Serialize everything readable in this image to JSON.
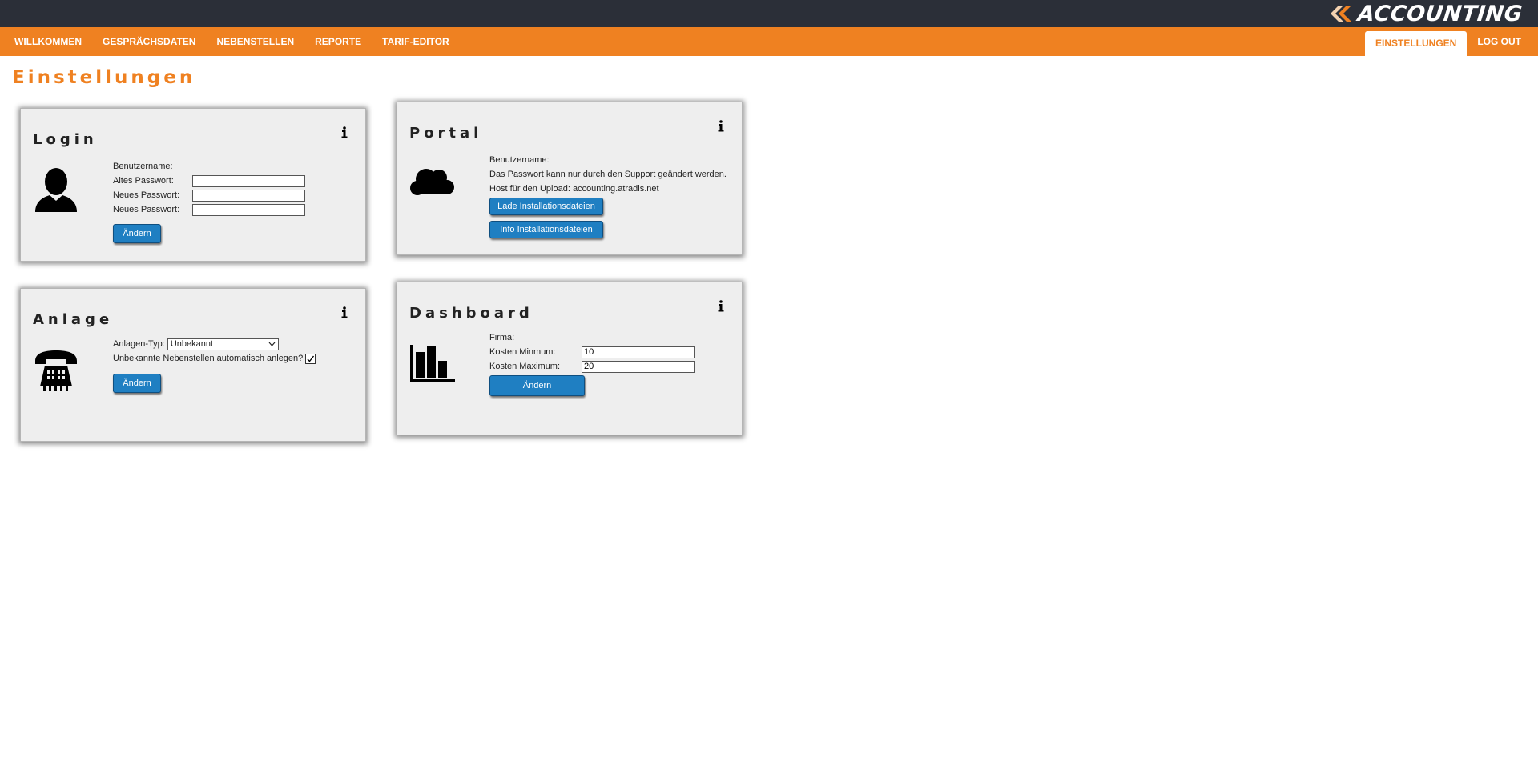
{
  "header": {
    "logo_text": "ACCOUNTING",
    "brand_color": "#ef8121",
    "topbar_color": "#2b2f38"
  },
  "nav": {
    "left": [
      "WILLKOMMEN",
      "GESPRÄCHSDATEN",
      "NEBENSTELLEN",
      "REPORTE",
      "TARIF-EDITOR"
    ],
    "settings": "EINSTELLUNGEN",
    "logout": "LOG OUT",
    "active": "EINSTELLUNGEN"
  },
  "page": {
    "title": "Einstellungen"
  },
  "login": {
    "title": "Login",
    "icon": "user-icon",
    "username_label": "Benutzername:",
    "old_password_label": "Altes Passwort:",
    "new_password_label": "Neues Passwort:",
    "new_password_repeat_label": "Neues Passwort:",
    "old_password_value": "",
    "new_password_value": "",
    "new_password_repeat_value": "",
    "submit_label": "Ändern"
  },
  "portal": {
    "title": "Portal",
    "icon": "cloud-icon",
    "username_label": "Benutzername:",
    "password_note": "Das Passwort kann nur durch den Support geändert werden.",
    "host_text": "Host für den Upload: accounting.atradis.net",
    "load_button": "Lade Installationsdateien",
    "info_button": "Info Installationsdateien"
  },
  "anlage": {
    "title": "Anlage",
    "icon": "telephone-icon",
    "type_label": "Anlagen-Typ:",
    "type_value": "Unbekannt",
    "auto_create_label": "Unbekannte Nebenstellen automatisch anlegen?",
    "auto_create_checked": true,
    "submit_label": "Ändern"
  },
  "dashboard": {
    "title": "Dashboard",
    "icon": "bar-chart-icon",
    "company_label": "Firma:",
    "cost_min_label": "Kosten Minmum:",
    "cost_min_value": "10",
    "cost_max_label": "Kosten Maximum:",
    "cost_max_value": "20",
    "submit_label": "Ändern"
  }
}
